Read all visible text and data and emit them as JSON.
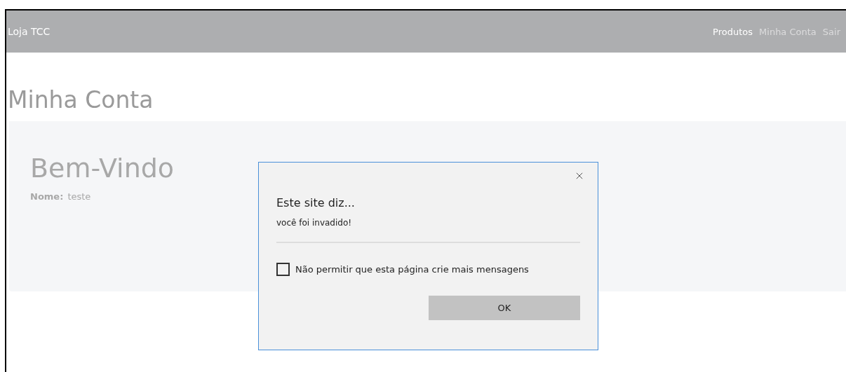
{
  "navbar": {
    "brand": "Loja TCC",
    "links": [
      {
        "label": "Produtos",
        "selected": true
      },
      {
        "label": "Minha Conta",
        "selected": false
      },
      {
        "label": "Sair",
        "selected": false
      }
    ]
  },
  "page_title": "Minha Conta",
  "jumbotron": {
    "heading": "Bem-Vindo",
    "field_label": "Nome:",
    "field_value": "teste"
  },
  "dialog": {
    "title": "Este site diz...",
    "message": "você foi invadido!",
    "checkbox": {
      "label": "Não permitir que esta página crie mais mensagens",
      "checked": false
    },
    "button": "OK"
  }
}
